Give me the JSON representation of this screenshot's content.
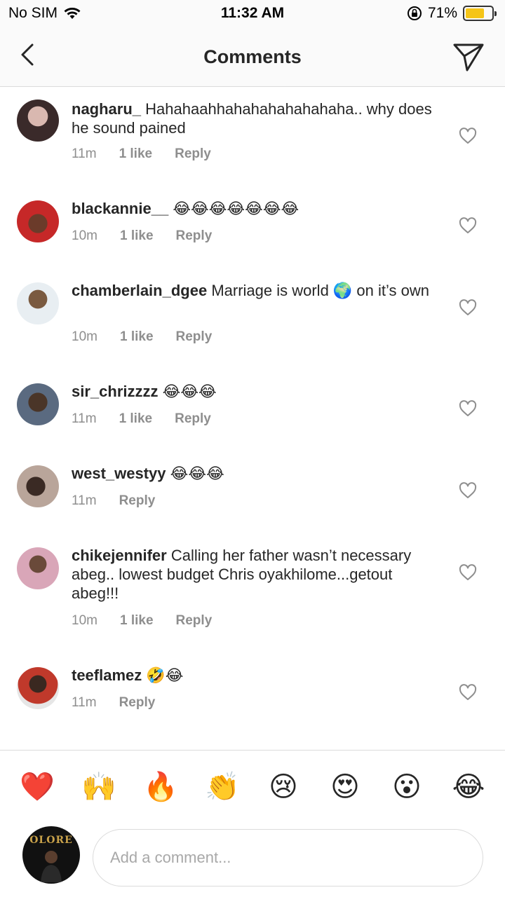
{
  "status_bar": {
    "carrier": "No SIM",
    "time": "11:32 AM",
    "battery": "71%",
    "battery_level": 0.71,
    "battery_color": "#f5c518"
  },
  "header": {
    "title": "Comments",
    "back_icon": "chevron-left-icon",
    "share_icon": "paper-plane-icon"
  },
  "comments": [
    {
      "username": "nagharu_",
      "text": "Hahahaahhahahahahahahaha.. why does he sound pained",
      "time": "11m",
      "likes": "1 like",
      "reply": "Reply"
    },
    {
      "username": "blackannie__",
      "text": "😂😂😂😂😂😂😂",
      "time": "10m",
      "likes": "1 like",
      "reply": "Reply"
    },
    {
      "username": "chamberlain_dgee",
      "text": "Marriage is world 🌍 on it’s own",
      "time": "10m",
      "likes": "1 like",
      "reply": "Reply"
    },
    {
      "username": "sir_chrizzzz",
      "text": "😂😂😂",
      "time": "11m",
      "likes": "1 like",
      "reply": "Reply"
    },
    {
      "username": "west_westyy",
      "text": "😂😂😂",
      "time": "11m",
      "likes": "",
      "reply": "Reply"
    },
    {
      "username": "chikejennifer",
      "text": "Calling her father wasn’t necessary abeg.. lowest budget Chris oyakhilome...getout abeg!!!",
      "time": "10m",
      "likes": "1 like",
      "reply": "Reply"
    },
    {
      "username": "teeflamez",
      "text": "🤣😂",
      "time": "11m",
      "likes": "",
      "reply": "Reply"
    }
  ],
  "emoji_bar": [
    "❤️",
    "🙌",
    "🔥",
    "👏",
    "😢",
    "😍",
    "😮",
    "😂"
  ],
  "input": {
    "placeholder": "Add a comment...",
    "avatar_text": "OLORE"
  },
  "colors": {
    "text": "#262626",
    "meta": "#8e8e8e",
    "divider": "#dbdbdb"
  }
}
